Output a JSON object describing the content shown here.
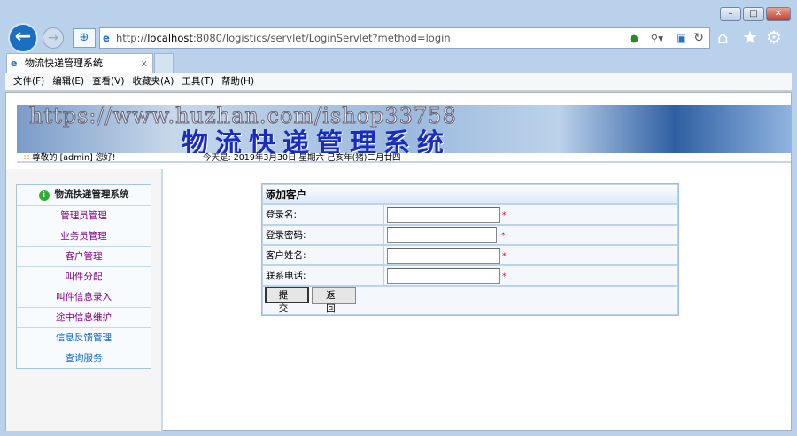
{
  "browser": {
    "url_prefix": "http://",
    "url_host": "localhost",
    "url_rest": ":8080/logistics/servlet/LoginServlet?method=login",
    "tab_title": "物流快递管理系统",
    "tab_close": "x",
    "menu": [
      "文件(F)",
      "编辑(E)",
      "查看(V)",
      "收藏夹(A)",
      "工具(T)",
      "帮助(H)"
    ]
  },
  "banner": {
    "watermark": "https://www.huzhan.com/ishop33758",
    "title": "物流快递管理系统",
    "greeting": "尊敬的 [admin] 您好!",
    "date": "今天是:  2019年3月30日 星期六 己亥年(猪)二月廿四"
  },
  "sidebar": {
    "header": "物流快递管理系统",
    "items": [
      {
        "label": "管理员管理",
        "visited": true
      },
      {
        "label": "业务员管理",
        "visited": true
      },
      {
        "label": "客户管理",
        "visited": true
      },
      {
        "label": "叫件分配",
        "visited": true
      },
      {
        "label": "叫件信息录入",
        "visited": true
      },
      {
        "label": "途中信息维护",
        "visited": true
      },
      {
        "label": "信息反馈管理",
        "visited": false
      },
      {
        "label": "查询服务",
        "visited": false
      }
    ]
  },
  "form": {
    "title": "添加客户",
    "fields": [
      {
        "label": "登录名:",
        "value": ""
      },
      {
        "label": "登录密码:",
        "value": ""
      },
      {
        "label": "客户姓名:",
        "value": ""
      },
      {
        "label": "联系电话:",
        "value": ""
      }
    ],
    "required_mark": "*",
    "submit": "提 交",
    "back": "返 回"
  }
}
